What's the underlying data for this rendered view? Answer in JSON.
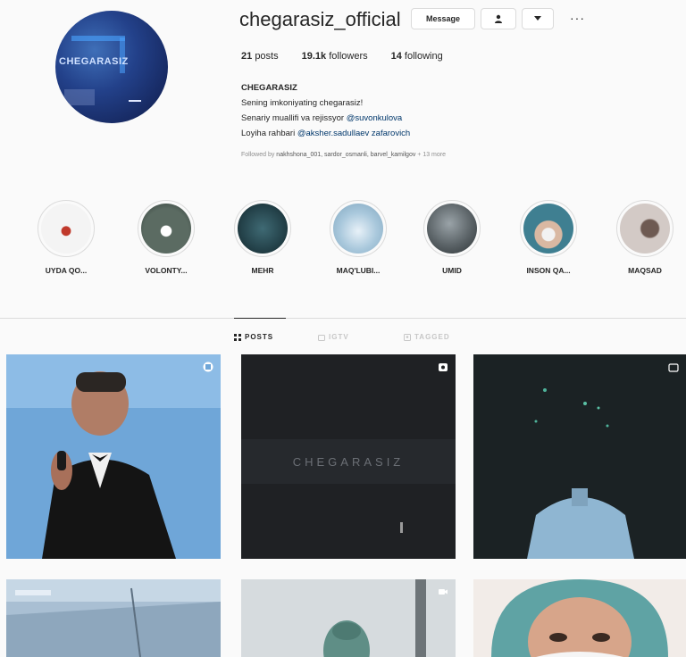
{
  "profile": {
    "username": "chegarasiz_official",
    "message_label": "Message",
    "follow_icon": "person-icon",
    "dropdown_icon": "chevron-down-icon",
    "more_label": "···",
    "stats": {
      "posts": "21",
      "posts_label": "posts",
      "followers": "19.1k",
      "followers_label": "followers",
      "following": "14",
      "following_label": "following"
    },
    "bio": {
      "name": "CHEGARASIZ",
      "line1": "Sening imkoniyating chegarasiz!",
      "line2_prefix": "Senariy muallifi va rejissyor ",
      "line2_mention": "@suvonkulova",
      "line3_prefix": "Loyiha rahbari ",
      "line3_mention": "@aksher.sadullaev zafarovich"
    },
    "followed_by": {
      "prefix": "Followed by ",
      "names": "nakhshona_001, sardor_osmanli, barvel_kamilgov",
      "suffix": " + 13 more"
    }
  },
  "highlights": [
    {
      "label": "UYDA QO...",
      "color": "#e9e9e9"
    },
    {
      "label": "VOLONTY...",
      "color": "#4a5a52"
    },
    {
      "label": "MEHR",
      "color": "#2e4e58"
    },
    {
      "label": "MAQ'LUBI...",
      "color": "#a9c8dc"
    },
    {
      "label": "UMID",
      "color": "#646b70"
    },
    {
      "label": "INSON QA...",
      "color": "#3f6f82"
    },
    {
      "label": "MAQSAD",
      "color": "#c8bfbd"
    }
  ],
  "tabs": {
    "posts": "POSTS",
    "igtv": "IGTV",
    "tagged": "TAGGED"
  },
  "posts": {
    "p2_text": "CHEGARASIZ"
  }
}
